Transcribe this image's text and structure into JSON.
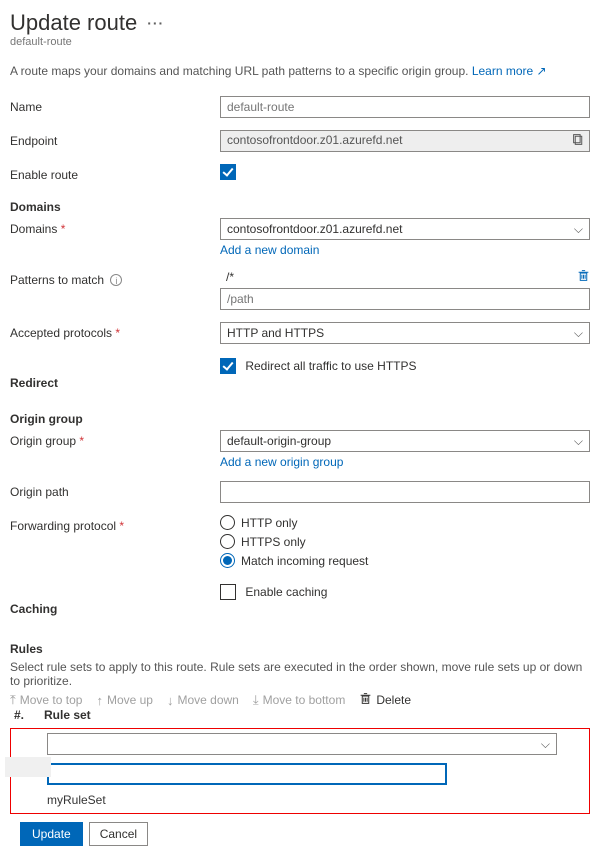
{
  "header": {
    "title": "Update route",
    "subtitle": "default-route"
  },
  "description": {
    "text": "A route maps your domains and matching URL path patterns to a specific origin group.",
    "learn_more": "Learn more"
  },
  "fields": {
    "name_label": "Name",
    "name_value": "default-route",
    "endpoint_label": "Endpoint",
    "endpoint_value": "contosofrontdoor.z01.azurefd.net",
    "enable_route_label": "Enable route",
    "domains_section": "Domains",
    "domains_label": "Domains",
    "domains_value": "contosofrontdoor.z01.azurefd.net",
    "add_domain_link": "Add a new domain",
    "patterns_label": "Patterns to match",
    "pattern_value": "/*",
    "pattern_placeholder": "/path",
    "accepted_protocols_label": "Accepted protocols",
    "accepted_protocols_value": "HTTP and HTTPS",
    "redirect_section": "Redirect",
    "redirect_checkbox_label": "Redirect all traffic to use HTTPS",
    "origin_group_section": "Origin group",
    "origin_group_label": "Origin group",
    "origin_group_value": "default-origin-group",
    "add_origin_link": "Add a new origin group",
    "origin_path_label": "Origin path",
    "forwarding_protocol_label": "Forwarding protocol",
    "forwarding_options": {
      "http_only": "HTTP only",
      "https_only": "HTTPS only",
      "match": "Match incoming request"
    },
    "caching_section": "Caching",
    "caching_checkbox_label": "Enable caching"
  },
  "rules": {
    "section": "Rules",
    "description": "Select rule sets to apply to this route. Rule sets are executed in the order shown, move rule sets up or down to prioritize.",
    "toolbar": {
      "move_top": "Move to top",
      "move_up": "Move up",
      "move_down": "Move down",
      "move_bottom": "Move to bottom",
      "delete": "Delete"
    },
    "table": {
      "col_num": "#.",
      "col_rule_set": "Rule set",
      "dropdown_value": "",
      "dropdown_option": "myRuleSet"
    }
  },
  "buttons": {
    "update": "Update",
    "cancel": "Cancel"
  }
}
